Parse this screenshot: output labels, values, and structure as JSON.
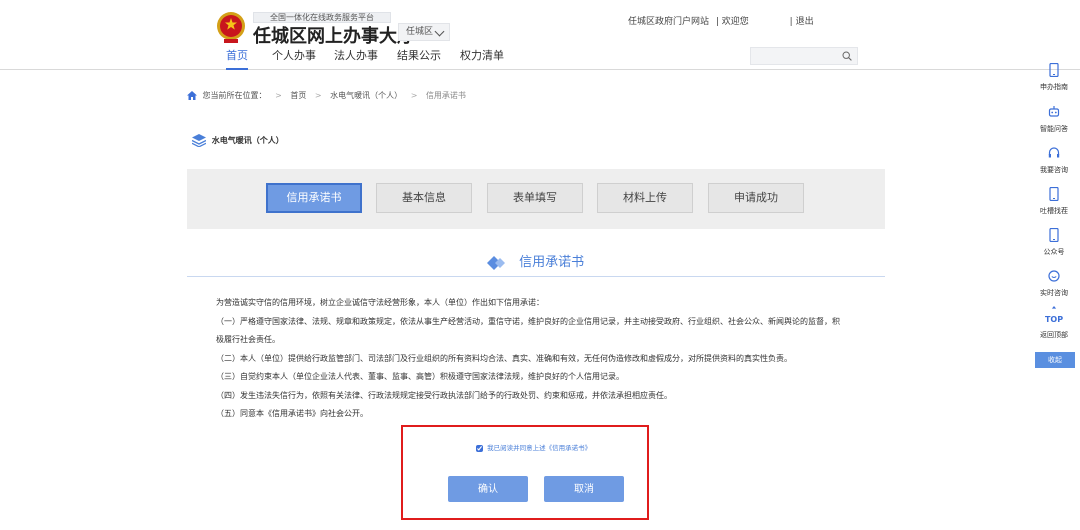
{
  "header": {
    "subtitle": "全国一体化在线政务服务平台",
    "title": "任城区网上办事大厅",
    "region": "任城区",
    "portal_link": "任城区政府门户网站",
    "welcome": "|  欢迎您",
    "logout": "|  退出",
    "nav": [
      "首页",
      "个人办事",
      "法人办事",
      "结果公示",
      "权力清单"
    ],
    "search_placeholder": ""
  },
  "breadcrumb": {
    "prefix": "您当前所在位置：",
    "items": [
      "首页",
      "水电气暖讯（个人）",
      "信用承诺书"
    ]
  },
  "service_title": "水电气暖讯（个人）",
  "steps": [
    "信用承诺书",
    "基本信息",
    "表单填写",
    "材料上传",
    "申请成功"
  ],
  "section_heading": "信用承诺书",
  "commitment": {
    "intro": "为营造诚实守信的信用环境，树立企业诚信守法经营形象，本人（单位）作出如下信用承诺：",
    "item1_a": "（一）严格遵守国家法律、法规、规章和政策规定，依法从事生产经营活动，重信守诺，维护良好的企业信用记录，并主动接受政府、行业组织、社会公众、新闻舆论的监督，积",
    "item1_b": "极履行社会责任。",
    "item2": "（二）本人（单位）提供给行政监管部门、司法部门及行业组织的所有资料均合法、真实、准确和有效，无任何伪造修改和虚假成分，对所提供资料的真实性负责。",
    "item3": "（三）自觉约束本人（单位企业法人代表、董事、监事、高管）积极遵守国家法律法规，维护良好的个人信用记录。",
    "item4": "（四）发生违法失信行为，依照有关法律、行政法规规定接受行政执法部门给予的行政处罚、约束和惩戒，并依法承担相应责任。",
    "item5": "（五）同意本《信用承诺书》向社会公开。"
  },
  "confirm": {
    "agree_label": "我已阅读并同意上述《信用承诺书》",
    "agree_checked": true,
    "confirm_button": "确认",
    "cancel_button": "取消"
  },
  "sidebar": {
    "items": [
      "申办指南",
      "智能问答",
      "我要咨询",
      "吐槽找茬",
      "公众号",
      "实时咨询",
      "返回顶部"
    ],
    "top_label": "TOP",
    "collapse": "收起"
  },
  "colors": {
    "accent": "#3c6fd8",
    "button": "#6f9be3",
    "highlight_border": "#e01c1c"
  }
}
